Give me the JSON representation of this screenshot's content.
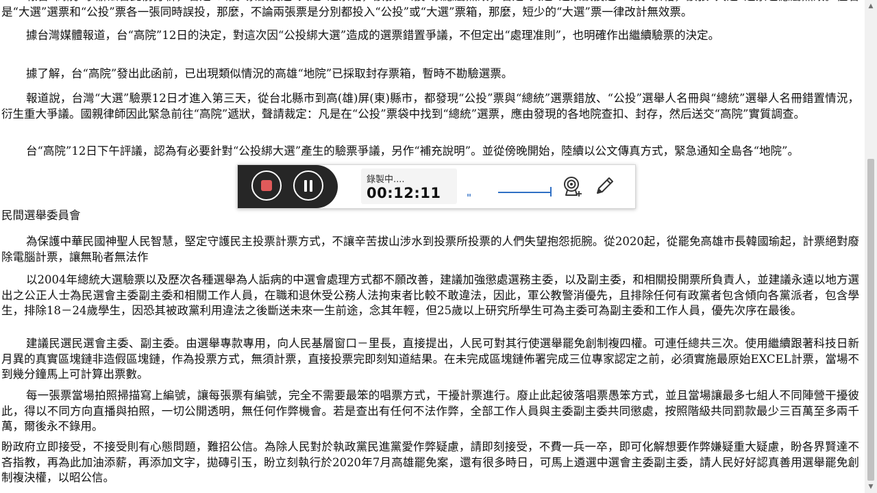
{
  "document": {
    "paragraphs": [
      "報台“高院”承辦法官此前分析，若是“公投”票誤投進“大選”選票箱，該張“公投”票應屬無效；若是“大選”選票誤投進“公投”票箱，該張“大選”選票也應屬無效。但若是“大選”選票和“公投”票各一張同時誤投，那麼，不論兩張票是分別都投入“公投”或“大選”票箱，那麼，短少的“大選”票一律改計無效票。",
      "據台灣媒體報道，台“高院”12日的決定，對這次因“公投綁大選”造成的選票錯置爭議，不但定出“處理准則”，也明確作出繼續驗票的決定。",
      "據了解，台“高院”發出此函前，已出現類似情況的高雄“地院”已採取封存票箱，暫時不勘驗選票。",
      "報道說，台灣“大選”驗票12日才進入第三天，從台北縣市到高(雄)屏(東)縣市，都發現“公投”票與“總統”選票錯放、“公投”選舉人名冊與“總統”選舉人名冊錯置情況，衍生重大爭議。國親律師因此緊急前往“高院”遞狀，聲請裁定：凡是在“公投”票袋中找到“總統”選票，應由發現的各地院查扣、封存，然后送交“高院”實質調查。",
      "台“高院”12日下午評議，認為有必要針對“公投綁大選”產生的驗票爭議，另作“補充說明”。並從傍晚開始，陸續以公文傳真方式，緊急通知全島各“地院”。"
    ],
    "section_heading": "民間選舉委員會",
    "section_paragraphs": [
      "為保護中華民國神聖人民智慧，堅定守護民主投票計票方式，不讓辛苦拔山涉水到投票所投票的人們失望抱怨扼腕。從2020起，從罷免高雄市長韓國瑜起，計票絕對廢除電腦計票，讓無恥者無法作",
      "以2004年總統大選驗票以及歷次各種選舉為人詬病的中選會處理方式都不願改善，建議加強懲處選務主委，以及副主委，和相關投開票所負責人，並建議永遠以地方選出之公正人士為民選會主委副主委和相關工作人員，在職和退休受公務人法拘束者比較不敢違法，因此，軍公教警消優先，且排除任何有政黨者包含傾向各黨派者，包含學生，排除18－24歲學生，因恐其被政黨利用違法之後斷送未來一生前途，念其年輕，但25歲以上研究所學生可為主委可為副主委和工作人員，優先次序在最後。",
      "建議民選民選會主委、副主委。由選舉專款專用，向人民基層窗口－里長，直接提出，人民可對其行使選舉罷免創制複四權。可連任總共三次。使用繼續跟著科技日新月異的真實區塊鏈非造假區塊鏈，作為投票方式，無須計票，直接投票完即刻知道結果。在未完成區塊鏈佈署完成三位專家認定之前，必須實施最原始EXCEL計票，當場不到幾分鐘馬上可計算出票數。",
      "每一張票當場拍照掃描寫上編號，讓每張票有編號，完全不需要最笨的唱票方式，干擾計票進行。廢止此起彼落唱票愚笨方式，並且當場讓最多七組人不同陣營干擾彼此，得以不同方向直播與拍照，一切公開透明，無任何作弊機會。若是查出有任何不法作弊，全部工作人員與主委副主委共同懲處，按照階級共同罰款最少三百萬至多兩千萬，爾後永不錄用。",
      "盼政府立即接受，不接受則有心態問題，難招公信。為除人民對於執政黨民進黨愛作弊疑慮，請即刻接受，不費一兵一卒，即可化解想要作弊嫌疑重大疑慮，盼各界賢達不吝指教，再為此加油添薪，再添加文字，拋磚引玉，盼立刻執行於2020年7月高雄罷免案，還有很多時日，可馬上遴選中選會主委副主委，請人民好好認真善用選舉罷免創制複決權，以昭公信。"
    ]
  },
  "recorder": {
    "status": "錄製中....",
    "elapsed": "00:12:11",
    "volume_level": 1.0,
    "icons": {
      "stop": "stop-icon",
      "pause": "pause-icon",
      "webcam": "webcam-icon",
      "pen": "pen-icon"
    },
    "colors": {
      "stop": "#e05a5a",
      "panel": "#262626",
      "accent": "#2f6fc4"
    }
  }
}
